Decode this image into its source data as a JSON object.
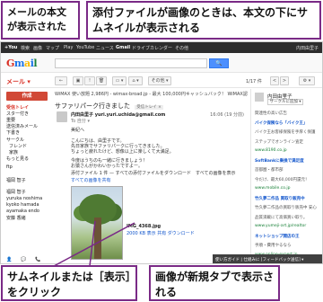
{
  "callouts": {
    "top_left": "メールの本文が表示された",
    "top_right": "添付ファイルが画像のときは、本文の下にサムネイルが表示される",
    "bottom_left": "サムネイルまたは［表示］をクリック",
    "bottom_right": "画像が新規タブで表示される"
  },
  "gbar": {
    "items": [
      "+You",
      "検索",
      "画像",
      "マップ",
      "Play",
      "YouTube",
      "ニュース",
      "Gmail",
      "ドライブ",
      "カレンダー",
      "その他"
    ],
    "right": "内田由里子"
  },
  "logo": {
    "g1": "G",
    "g2": "m",
    "g3": "a",
    "g4": "i",
    "g5": "l"
  },
  "search": {
    "placeholder": "",
    "button": "🔍"
  },
  "toolbar": {
    "mail_label": "メール ▾",
    "back": "←",
    "archive": "▣",
    "spam": "!",
    "delete": "🗑",
    "move": "▭ ▾",
    "label": "⌂ ▾",
    "more": "その他 ▾",
    "pager": "1/17 件",
    "prev": "<",
    "next": ">",
    "settings": "⚙ ▾"
  },
  "sidebar": {
    "compose": "作成",
    "items": [
      "受信トレイ",
      "スター付き",
      "重要",
      "送信済みメール",
      "下書き",
      "サークル",
      "フレンド",
      "家族",
      "もっと見る",
      "",
      "ftp",
      "",
      "福岡 智子",
      "",
      "福岡 智子",
      "",
      "yuruka noshima",
      "kyoko hamada",
      "ayamaka endo",
      "安藤 香緒"
    ],
    "active_index": 0
  },
  "bottombar": {
    "b1": "👤",
    "b2": "💬",
    "b3": "📞"
  },
  "main": {
    "ad": "WiMAX 使い放題 2,986円 - wimax-broad.jp - 最大 100,000円キャッシュバック！ WiMAX認定正規代理店。業界...",
    "subject": "サファリパーク行きました",
    "subject_tag": "受信トレイ ×",
    "sender": "内田由里子 yuri.yuri.uchida@gmail.com",
    "date": "16:06 (19 分前)",
    "to": "To 自分 ▾",
    "body": [
      "美紀へ",
      "",
      "こんにちは、由里子です。",
      "先日家族でサファリパークに行ってきました。",
      "ちょっと疲れたけど、想像以上に楽しくて大満足。",
      "",
      "今度はうちのも一緒に行きましょう！",
      "お猿さんがかわいかったですよー。"
    ],
    "attach_head": "添付ファイル 1 件 — すべての添付ファイルをダウンロード　すべての画像を表示",
    "attach_links": "すべての画像を共有",
    "attachment": {
      "name": "IMG_4368.jpg",
      "meta": "2000 KB 表示 共有 ダウンロード"
    }
  },
  "rightpane": {
    "name": "内田由里子",
    "button": "サークルに追加 ▾",
    "lines": [
      {
        "text": "関連性の高い広告",
        "style": ""
      },
      {
        "text": "バイク保険なら「バイク王」",
        "style": "link"
      },
      {
        "text": "バイク王お客様保険を手厚く保護",
        "style": ""
      },
      {
        "text": "ステップでオンライン査定",
        "style": ""
      },
      {
        "text": "www.8190.co.jp",
        "style": "green"
      },
      {
        "text": "SoftBankに乗換で満足度",
        "style": "link"
      },
      {
        "text": "首都圏・都市部",
        "style": ""
      },
      {
        "text": "今だけ、最大60,000円還元！",
        "style": ""
      },
      {
        "text": "www.mobile.co.jp",
        "style": "green"
      },
      {
        "text": "竹久夢二作品 買取り販売中",
        "style": "link"
      },
      {
        "text": "竹久夢二作品の買取り販売中 安心",
        "style": ""
      },
      {
        "text": "品質満載にて高価買い取り。",
        "style": ""
      },
      {
        "text": "www.yumeji-art.jp/realtor",
        "style": "green"
      },
      {
        "text": "ネットショップ開店の王",
        "style": "link"
      },
      {
        "text": "手順・費用やるなら",
        "style": ""
      },
      {
        "text": "www.online-expert.jp",
        "style": "green"
      }
    ]
  },
  "popup_tab": "使い方ガイド | 仕組みに [フィードバック送信] ▾",
  "colors": {
    "callout_border": "#7a2a86",
    "compose": "#d14836",
    "link": "#1155cc"
  }
}
